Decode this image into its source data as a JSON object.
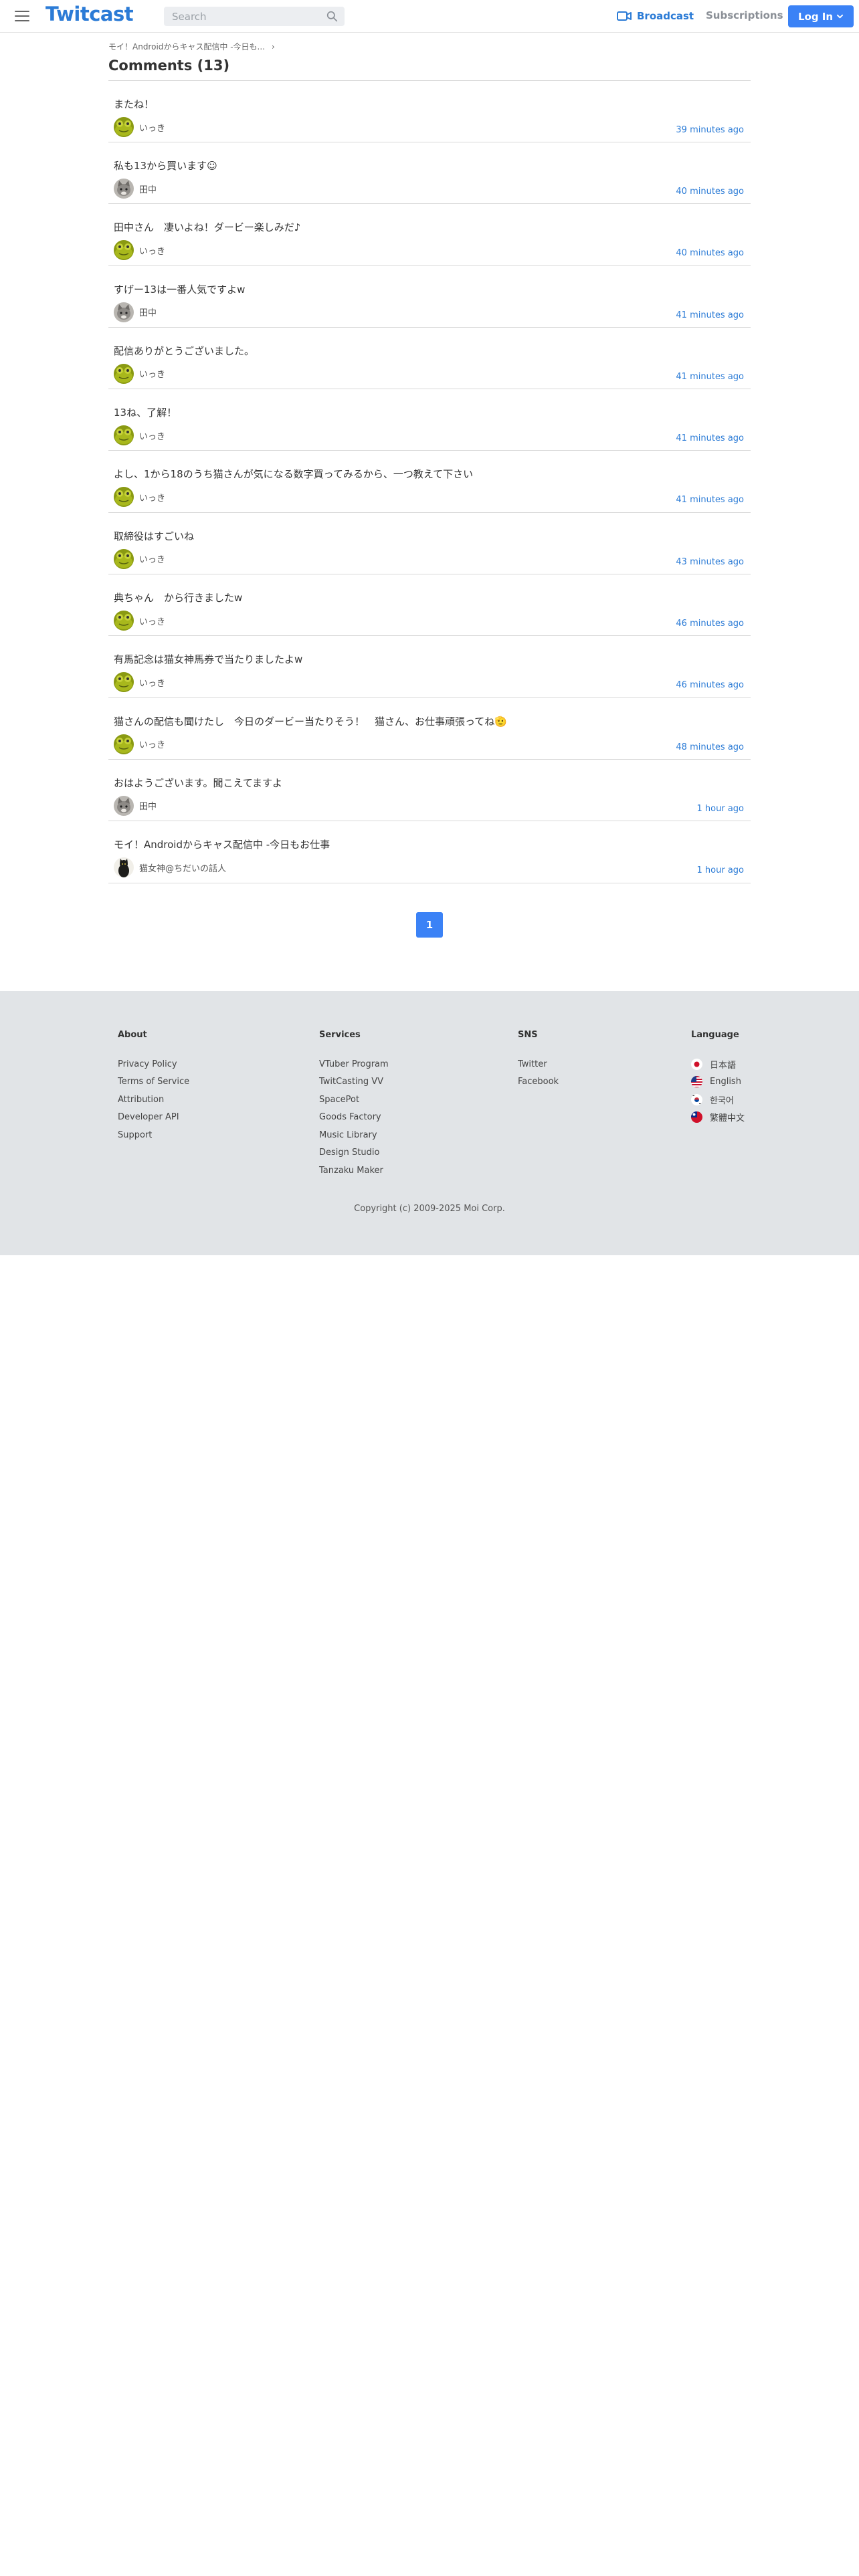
{
  "header": {
    "logo": "Twitcast",
    "search_placeholder": "Search",
    "broadcast_label": "Broadcast",
    "subscriptions_label": "Subscriptions",
    "login_label": "Log In",
    "brand_color": "#2b7bd6",
    "button_color": "#3b82f6"
  },
  "breadcrumb": {
    "label": "モイ！Androidからキャス配信中 -今日も..."
  },
  "page": {
    "title": "Comments (13)"
  },
  "comments": [
    {
      "text": "またね！",
      "author": "いっき",
      "avatar": "frog-avatar",
      "time": "39 minutes ago"
    },
    {
      "text": "私も13から買います☺",
      "author": "田中",
      "avatar": "cat-avatar",
      "time": "40 minutes ago"
    },
    {
      "text": "田中さん　凄いよね！ダービー楽しみだ♪",
      "author": "いっき",
      "avatar": "frog-avatar",
      "time": "40 minutes ago"
    },
    {
      "text": "すげー13は一番人気ですよw",
      "author": "田中",
      "avatar": "cat-avatar",
      "time": "41 minutes ago"
    },
    {
      "text": "配信ありがとうございました。",
      "author": "いっき",
      "avatar": "frog-avatar",
      "time": "41 minutes ago"
    },
    {
      "text": "13ね、了解！",
      "author": "いっき",
      "avatar": "frog-avatar",
      "time": "41 minutes ago"
    },
    {
      "text": "よし、1から18のうち猫さんが気になる数字買ってみるから、一つ教えて下さい",
      "author": "いっき",
      "avatar": "frog-avatar",
      "time": "41 minutes ago"
    },
    {
      "text": "取締役はすごいね",
      "author": "いっき",
      "avatar": "frog-avatar",
      "time": "43 minutes ago"
    },
    {
      "text": "典ちゃん　から行きましたw",
      "author": "いっき",
      "avatar": "frog-avatar",
      "time": "46 minutes ago"
    },
    {
      "text": "有馬記念は猫女神馬券で当たりましたよw",
      "author": "いっき",
      "avatar": "frog-avatar",
      "time": "46 minutes ago"
    },
    {
      "text": "猫さんの配信も聞けたし　今日のダービー当たりそう！　猫さん、お仕事頑張ってね🫡",
      "author": "いっき",
      "avatar": "frog-avatar",
      "time": "48 minutes ago"
    },
    {
      "text": "おはようございます。聞こえてますよ",
      "author": "田中",
      "avatar": "cat-avatar",
      "time": "1 hour ago"
    },
    {
      "text": "モイ！Androidからキャス配信中 -今日もお仕事",
      "author": "猫女神@ちだいの話人",
      "avatar": "black-cat-avatar",
      "time": "1 hour ago"
    }
  ],
  "pagination": {
    "current_page": "1"
  },
  "footer": {
    "about": {
      "heading": "About",
      "links": [
        "Privacy Policy",
        "Terms of Service",
        "Attribution",
        "Developer API",
        "Support"
      ]
    },
    "services": {
      "heading": "Services",
      "links": [
        "VTuber Program",
        "TwitCasting VV",
        "SpacePot",
        "Goods Factory",
        "Music Library",
        "Design Studio",
        "Tanzaku Maker"
      ]
    },
    "sns": {
      "heading": "SNS",
      "links": [
        "Twitter",
        "Facebook"
      ]
    },
    "language": {
      "heading": "Language",
      "links": [
        {
          "label": "日本語",
          "flag": "japan-flag-icon"
        },
        {
          "label": "English",
          "flag": "us-flag-icon"
        },
        {
          "label": "한국어",
          "flag": "korea-flag-icon"
        },
        {
          "label": "繁體中文",
          "flag": "taiwan-flag-icon"
        }
      ]
    },
    "copyright": "Copyright (c) 2009-2025 Moi Corp."
  }
}
